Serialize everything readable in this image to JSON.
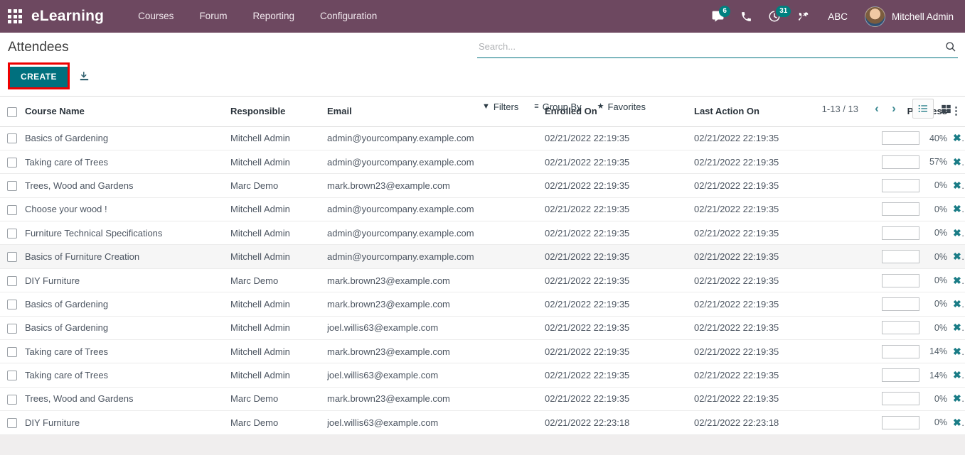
{
  "navbar": {
    "apps_icon": "apps-grid-icon",
    "brand": "eLearning",
    "menu": [
      {
        "label": "Courses"
      },
      {
        "label": "Forum"
      },
      {
        "label": "Reporting"
      },
      {
        "label": "Configuration"
      }
    ],
    "icons": [
      {
        "name": "messages-icon",
        "badge": "6"
      },
      {
        "name": "phone-icon",
        "badge": ""
      },
      {
        "name": "activities-clock-icon",
        "badge": "31"
      },
      {
        "name": "tools-icon",
        "badge": ""
      }
    ],
    "company_label": "ABC",
    "user_name": "Mitchell Admin",
    "bg_color": "#6d4860",
    "badge_color": "#00807f"
  },
  "control_panel": {
    "breadcrumb": "Attendees",
    "create_label": "CREATE",
    "create_accent": "#00707e",
    "highlight_color": "#ee0000",
    "import_icon": "import-icon",
    "search": {
      "placeholder": "Search...",
      "value": ""
    },
    "search_icon": "search-icon",
    "filters": [
      {
        "glyph": "▼",
        "label": "Filters",
        "name": "filters-dropdown"
      },
      {
        "glyph": "≡",
        "label": "Group By",
        "name": "group-by-dropdown"
      },
      {
        "glyph": "★",
        "label": "Favorites",
        "name": "favorites-dropdown"
      }
    ],
    "pager": {
      "count": "1-13 / 13",
      "prev": "‹",
      "next": "›"
    },
    "views": [
      {
        "name": "list-view-button",
        "active": true
      },
      {
        "name": "kanban-view-button",
        "active": false
      }
    ]
  },
  "table": {
    "columns": [
      {
        "key": "course",
        "label": "Course Name"
      },
      {
        "key": "responsible",
        "label": "Responsible"
      },
      {
        "key": "email",
        "label": "Email"
      },
      {
        "key": "enrolled_on",
        "label": "Enrolled On"
      },
      {
        "key": "last_action_on",
        "label": "Last Action On"
      },
      {
        "key": "progress",
        "label": "Progress"
      }
    ],
    "options_icon": "⋮",
    "rows": [
      {
        "course": "Basics of Gardening",
        "responsible": "Mitchell Admin",
        "email": "admin@yourcompany.example.com",
        "enrolled_on": "02/21/2022 22:19:35",
        "last_action_on": "02/21/2022 22:19:35",
        "progress": 40,
        "progress_label": "40%",
        "shaded": false
      },
      {
        "course": "Taking care of Trees",
        "responsible": "Mitchell Admin",
        "email": "admin@yourcompany.example.com",
        "enrolled_on": "02/21/2022 22:19:35",
        "last_action_on": "02/21/2022 22:19:35",
        "progress": 57,
        "progress_label": "57%",
        "shaded": false
      },
      {
        "course": "Trees, Wood and Gardens",
        "responsible": "Marc Demo",
        "email": "mark.brown23@example.com",
        "enrolled_on": "02/21/2022 22:19:35",
        "last_action_on": "02/21/2022 22:19:35",
        "progress": 0,
        "progress_label": "0%",
        "shaded": false
      },
      {
        "course": "Choose your wood !",
        "responsible": "Mitchell Admin",
        "email": "admin@yourcompany.example.com",
        "enrolled_on": "02/21/2022 22:19:35",
        "last_action_on": "02/21/2022 22:19:35",
        "progress": 0,
        "progress_label": "0%",
        "shaded": false
      },
      {
        "course": "Furniture Technical Specifications",
        "responsible": "Mitchell Admin",
        "email": "admin@yourcompany.example.com",
        "enrolled_on": "02/21/2022 22:19:35",
        "last_action_on": "02/21/2022 22:19:35",
        "progress": 0,
        "progress_label": "0%",
        "shaded": false
      },
      {
        "course": "Basics of Furniture Creation",
        "responsible": "Mitchell Admin",
        "email": "admin@yourcompany.example.com",
        "enrolled_on": "02/21/2022 22:19:35",
        "last_action_on": "02/21/2022 22:19:35",
        "progress": 0,
        "progress_label": "0%",
        "shaded": true
      },
      {
        "course": "DIY Furniture",
        "responsible": "Marc Demo",
        "email": "mark.brown23@example.com",
        "enrolled_on": "02/21/2022 22:19:35",
        "last_action_on": "02/21/2022 22:19:35",
        "progress": 0,
        "progress_label": "0%",
        "shaded": false
      },
      {
        "course": "Basics of Gardening",
        "responsible": "Mitchell Admin",
        "email": "mark.brown23@example.com",
        "enrolled_on": "02/21/2022 22:19:35",
        "last_action_on": "02/21/2022 22:19:35",
        "progress": 0,
        "progress_label": "0%",
        "shaded": false
      },
      {
        "course": "Basics of Gardening",
        "responsible": "Mitchell Admin",
        "email": "joel.willis63@example.com",
        "enrolled_on": "02/21/2022 22:19:35",
        "last_action_on": "02/21/2022 22:19:35",
        "progress": 0,
        "progress_label": "0%",
        "shaded": false
      },
      {
        "course": "Taking care of Trees",
        "responsible": "Mitchell Admin",
        "email": "mark.brown23@example.com",
        "enrolled_on": "02/21/2022 22:19:35",
        "last_action_on": "02/21/2022 22:19:35",
        "progress": 14,
        "progress_label": "14%",
        "shaded": false
      },
      {
        "course": "Taking care of Trees",
        "responsible": "Mitchell Admin",
        "email": "joel.willis63@example.com",
        "enrolled_on": "02/21/2022 22:19:35",
        "last_action_on": "02/21/2022 22:19:35",
        "progress": 14,
        "progress_label": "14%",
        "shaded": false
      },
      {
        "course": "Trees, Wood and Gardens",
        "responsible": "Marc Demo",
        "email": "mark.brown23@example.com",
        "enrolled_on": "02/21/2022 22:19:35",
        "last_action_on": "02/21/2022 22:19:35",
        "progress": 0,
        "progress_label": "0%",
        "shaded": false
      },
      {
        "course": "DIY Furniture",
        "responsible": "Marc Demo",
        "email": "joel.willis63@example.com",
        "enrolled_on": "02/21/2022 22:23:18",
        "last_action_on": "02/21/2022 22:23:18",
        "progress": 0,
        "progress_label": "0%",
        "shaded": false
      }
    ],
    "delete_glyph": "✖"
  }
}
